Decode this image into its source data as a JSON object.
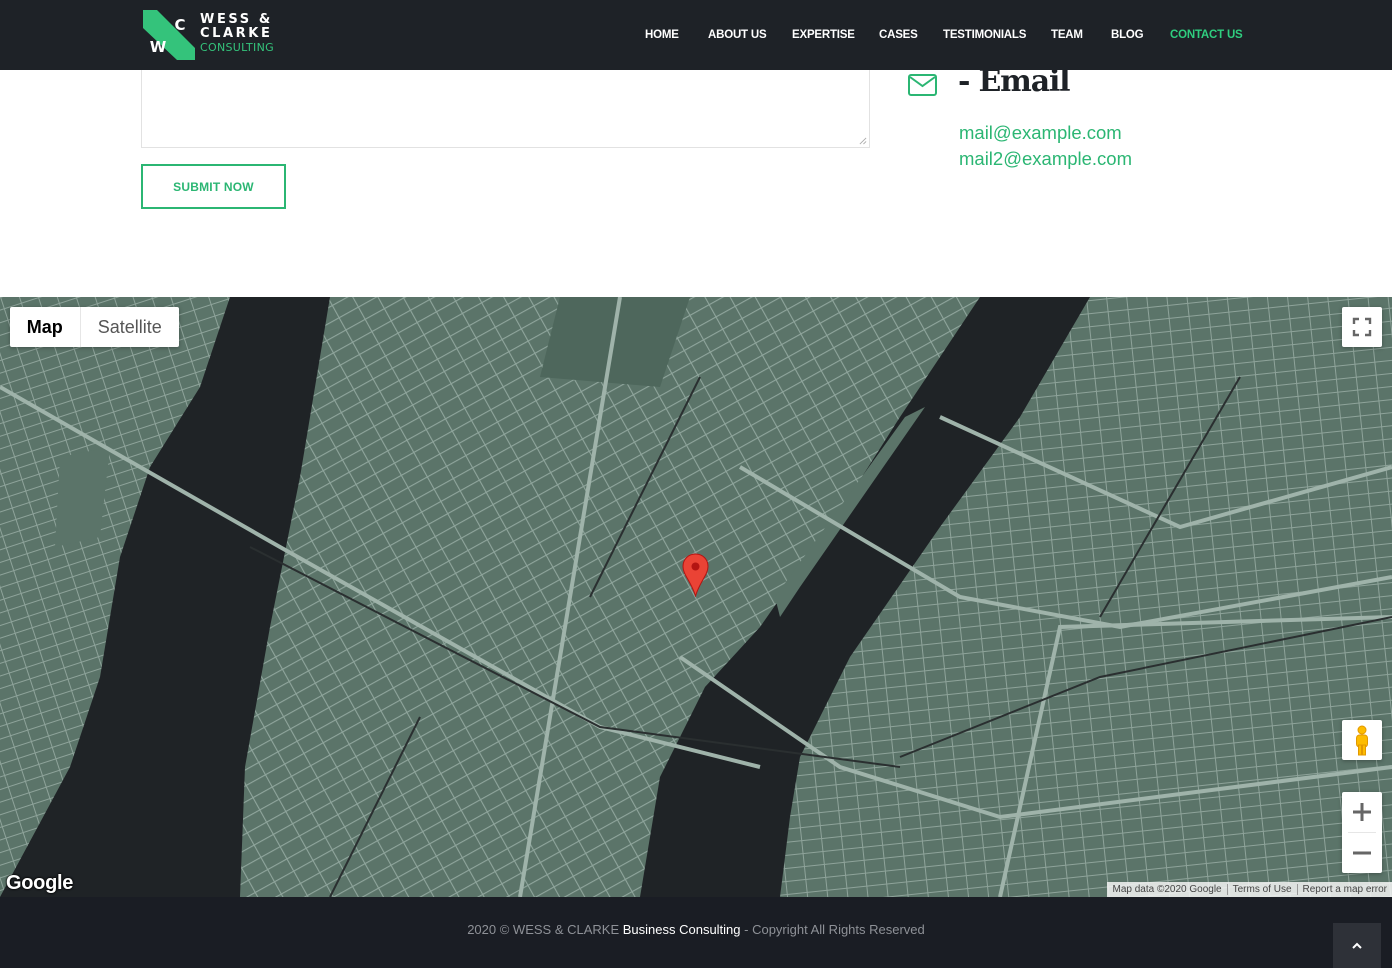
{
  "brand": {
    "logo_letters": [
      "C",
      "W"
    ],
    "line1": "WESS &",
    "line2": "CLARKE",
    "line3": "CONSULTING",
    "accent_color": "#2fce7f"
  },
  "nav": {
    "items": [
      {
        "label": "HOME"
      },
      {
        "label": "ABOUT US"
      },
      {
        "label": "EXPERTISE"
      },
      {
        "label": "CASES"
      },
      {
        "label": "TESTIMONIALS"
      },
      {
        "label": "TEAM"
      },
      {
        "label": "BLOG"
      },
      {
        "label": "CONTACT US",
        "active": true
      }
    ]
  },
  "form": {
    "message_value": "",
    "submit_label": "SUBMIT NOW"
  },
  "contact": {
    "email_title": "- Email",
    "emails": [
      "mail@example.com",
      "mail2@example.com"
    ],
    "icon": "mail-icon"
  },
  "map": {
    "type_controls": {
      "map": "Map",
      "satellite": "Satellite",
      "selected": "Map"
    },
    "controls": [
      "fullscreen-icon",
      "pegman-icon",
      "zoom-in-icon",
      "zoom-out-icon"
    ],
    "logo": "Google",
    "attribution": {
      "data": "Map data ©2020 Google",
      "terms": "Terms of Use",
      "report": "Report a map error"
    },
    "marker": "map-marker-icon",
    "land_color": "#5f7a6f",
    "water_color": "#1f2326",
    "road_color": "#8fa59c"
  },
  "footer": {
    "prefix": "2020 © WESS & CLARKE ",
    "highlight": "Business Consulting",
    "suffix": " - Copyright All Rights Reserved",
    "back_to_top_icon": "chevron-up-icon"
  }
}
